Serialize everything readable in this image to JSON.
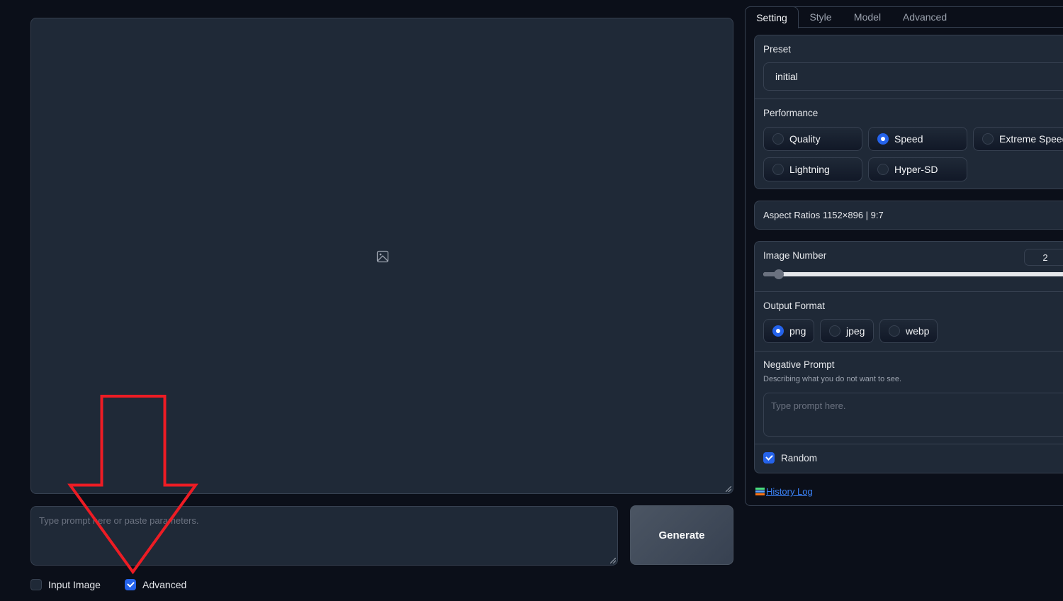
{
  "main": {
    "prompt_placeholder": "Type prompt here or paste parameters.",
    "prompt_value": "",
    "generate_label": "Generate",
    "image_icon": "image-placeholder-icon",
    "checkboxes": [
      {
        "label": "Input Image",
        "checked": false
      },
      {
        "label": "Advanced",
        "checked": true
      }
    ]
  },
  "annotation": {
    "shape": "arrow-down",
    "color": "#ed1c24",
    "target": "Advanced"
  },
  "sidebar": {
    "tabs": [
      {
        "label": "Setting",
        "active": true
      },
      {
        "label": "Style",
        "active": false
      },
      {
        "label": "Model",
        "active": false
      },
      {
        "label": "Advanced",
        "active": false
      }
    ],
    "preset": {
      "label": "Preset",
      "value": "initial"
    },
    "performance": {
      "label": "Performance",
      "options": [
        "Quality",
        "Speed",
        "Extreme Speed",
        "Lightning",
        "Hyper-SD"
      ],
      "selected": "Speed"
    },
    "aspect_ratios": {
      "label": "Aspect Ratios 1152×896 | 9:7"
    },
    "image_number": {
      "label": "Image Number",
      "value": "2",
      "min": 1,
      "max": 32
    },
    "output_format": {
      "label": "Output Format",
      "options": [
        "png",
        "jpeg",
        "webp"
      ],
      "selected": "png"
    },
    "negative_prompt": {
      "label": "Negative Prompt",
      "info": "Describing what you do not want to see.",
      "placeholder": "Type prompt here.",
      "value": ""
    },
    "random": {
      "label": "Random",
      "checked": true
    },
    "history_log": {
      "icon": "books-icon",
      "label": " History Log"
    }
  },
  "colors": {
    "accent": "#2563eb",
    "background": "#0b0f19",
    "panel": "#1f2937",
    "border": "#374151",
    "link": "#3b82f6"
  }
}
